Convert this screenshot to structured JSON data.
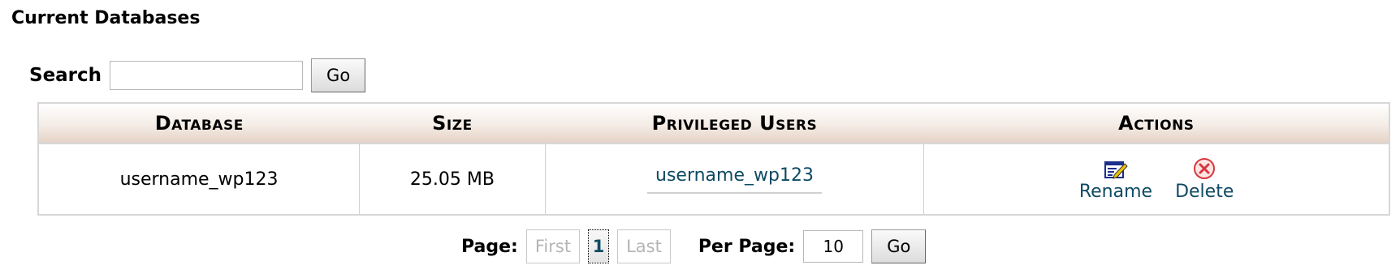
{
  "page_title": "Current Databases",
  "search": {
    "label": "Search",
    "value": "",
    "placeholder": "",
    "go_label": "Go"
  },
  "table": {
    "headers": [
      "Database",
      "Size",
      "Privileged Users",
      "Actions"
    ],
    "rows": [
      {
        "database": "username_wp123",
        "size": "25.05 MB",
        "privileged_user": "username_wp123",
        "actions": {
          "rename": "Rename",
          "delete": "Delete"
        }
      }
    ]
  },
  "pagination": {
    "label": "Page:",
    "first": "First",
    "current": "1",
    "last": "Last",
    "per_page_label": "Per Page:",
    "per_page_value": "10",
    "go_label": "Go"
  },
  "icons": {
    "rename": "rename-icon",
    "delete": "delete-icon"
  },
  "colors": {
    "link": "#0f4a64",
    "delete_icon": "#d9363e",
    "rename_icon": "#1c2f8a"
  }
}
